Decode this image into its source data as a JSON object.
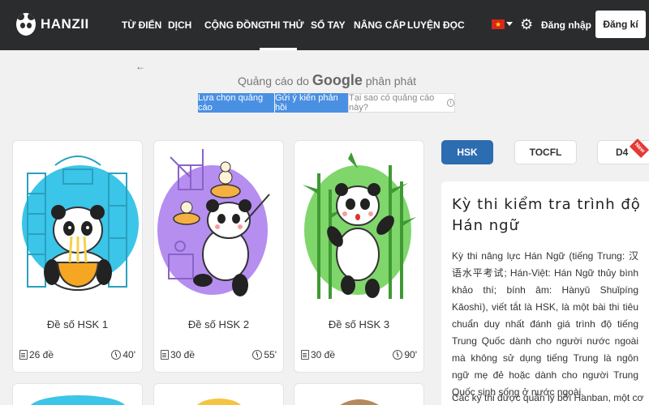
{
  "header": {
    "brand": "HANZII",
    "nav": [
      {
        "label": "TỪ ĐIỂN"
      },
      {
        "label": "DỊCH"
      },
      {
        "label": "CỘNG ĐỒNG"
      },
      {
        "label": "THI THỬ",
        "active": true
      },
      {
        "label": "SỔ TAY"
      },
      {
        "label": "NÂNG CẤP"
      },
      {
        "label": "LUYỆN ĐỌC"
      }
    ],
    "language_flag": "vietnam-flag-icon",
    "settings_icon": "gear-icon",
    "login_label": "Đăng nhập",
    "register_label": "Đăng kí"
  },
  "ad": {
    "back_icon": "arrow-left-icon",
    "title_prefix": "Quảng cáo do",
    "title_brand": "Google",
    "title_suffix": "phân phát",
    "btn_choice": "Lựa chọn quảng cáo",
    "btn_feedback": "Gửi ý kiến phản hồi",
    "btn_why": "Tại sao có quảng cáo này?"
  },
  "exams": [
    {
      "title": "Đề số HSK 1",
      "count": "26 đề",
      "duration": "40'"
    },
    {
      "title": "Đề số HSK 2",
      "count": "30 đề",
      "duration": "55'"
    },
    {
      "title": "Đề số HSK 3",
      "count": "30 đề",
      "duration": "90'"
    }
  ],
  "tabs": [
    {
      "label": "HSK",
      "active": true
    },
    {
      "label": "TOCFL"
    },
    {
      "label": "D4"
    }
  ],
  "new_badge": "New",
  "info": {
    "title": "Kỳ thi kiểm tra trình độ Hán ngữ",
    "body": "Kỳ thi năng lực Hán Ngữ (tiếng Trung: 汉语水平考试; Hán-Việt: Hán Ngữ thủy bình khảo thí; bính âm: Hànyǔ Shuǐpíng Kǎoshì), viết tắt là HSK, là một bài thi tiêu chuẩn duy nhất đánh giá trình độ tiếng Trung Quốc dành cho người nước ngoài mà không sử dụng tiếng Trung là ngôn ngữ mẹ đẻ hoặc dành cho người Trung Quốc sinh sống ở nước ngoài.",
    "body2": "Các kỳ thi được quản lý bởi Hanban, một cơ"
  },
  "colors": {
    "nav_bg": "#2b2c2e",
    "accent": "#2c6cb0",
    "ad_button": "#4a90e2",
    "hsk1_circle": "#3bc5e8",
    "hsk2_circle": "#b58ef0",
    "hsk3_circle": "#7fd66a",
    "new_badge": "#e53935"
  }
}
